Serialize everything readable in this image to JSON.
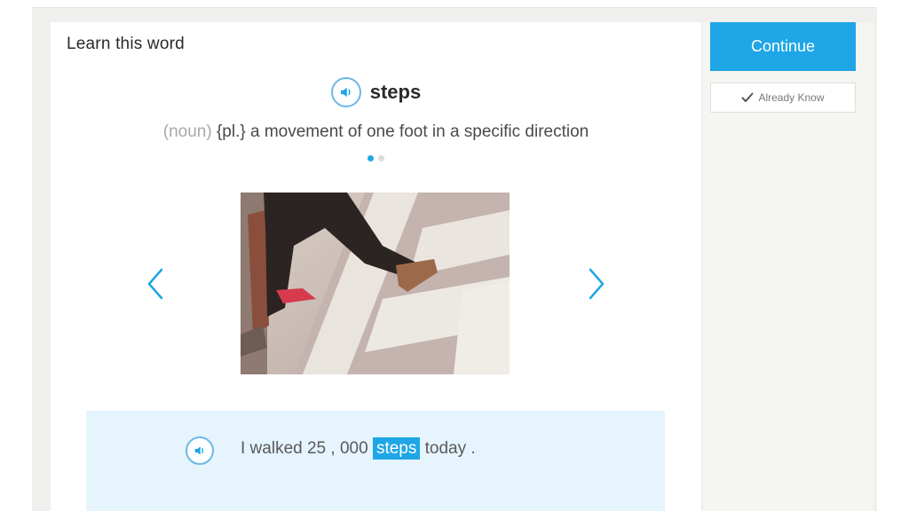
{
  "card": {
    "title": "Learn this word",
    "word": "steps",
    "part_of_speech": "(noun)",
    "definition": " {pl.} a movement of one foot in a specific direction",
    "slide_count": 2,
    "active_slide": 1
  },
  "example": {
    "before": "I walked 25 , 000 ",
    "highlight": "steps",
    "after": " today ."
  },
  "sidebar": {
    "continue_label": "Continue",
    "already_know_label": "Already Know"
  },
  "icons": {
    "word_audio": "speaker-icon",
    "example_audio": "speaker-icon",
    "prev": "chevron-left-icon",
    "next": "chevron-right-icon",
    "check": "checkmark-icon"
  },
  "colors": {
    "accent": "#1fa6e6",
    "example_bg": "#e5f4fd",
    "side_bg": "#f5f5f2"
  }
}
